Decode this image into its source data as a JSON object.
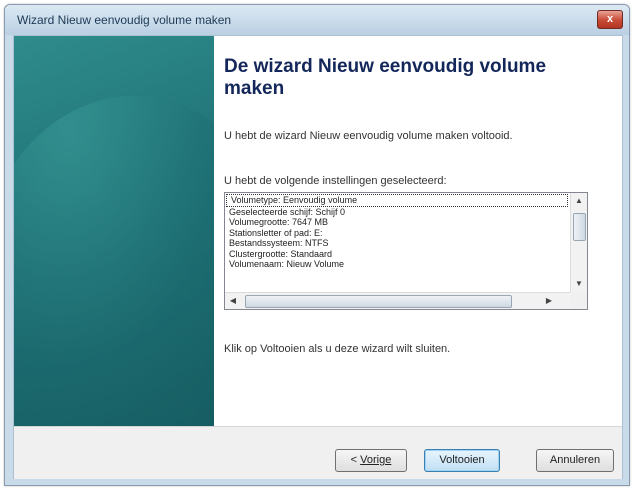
{
  "window": {
    "title": "Wizard Nieuw eenvoudig volume maken",
    "close_glyph": "x"
  },
  "content": {
    "heading": "De wizard Nieuw eenvoudig volume maken",
    "completed_text": "U hebt de wizard Nieuw eenvoudig volume maken voltooid.",
    "settings_intro": "U hebt de volgende instellingen geselecteerd:",
    "settings": [
      "Volumetype: Eenvoudig volume",
      "Geselecteerde schijf: Schijf 0",
      "Volumegrootte: 7647 MB",
      "Stationsletter of pad: E:",
      "Bestandssysteem: NTFS",
      "Clustergrootte: Standaard",
      "Volumenaam: Nieuw Volume"
    ],
    "close_hint": "Klik op Voltooien als u deze wizard wilt sluiten."
  },
  "buttons": {
    "back_prefix": "< ",
    "back_label": "Vorige",
    "finish_label": "Voltooien",
    "cancel_label": "Annuleren"
  },
  "icons": {
    "scroll_up": "up-arrow-icon",
    "scroll_down": "down-arrow-icon",
    "scroll_left": "left-arrow-icon",
    "scroll_right": "right-arrow-icon"
  }
}
